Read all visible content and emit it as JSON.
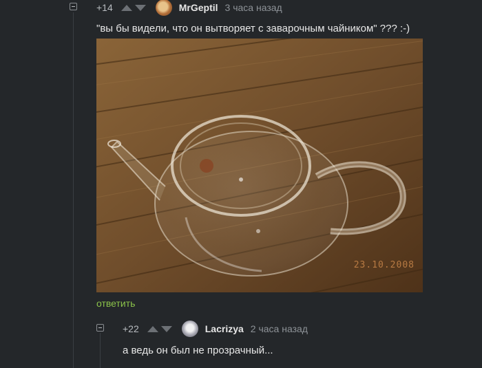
{
  "comment1": {
    "rating": "+14",
    "username": "MrGeptil",
    "timestamp": "3 часа назад",
    "text": "\"вы бы видели, что он вытворяет с заварочным чайником\" ??? :-)",
    "image_date_stamp": "23.10.2008",
    "reply_label": "ответить"
  },
  "comment2": {
    "rating": "+22",
    "username": "Lacrizya",
    "timestamp": "2 часа назад",
    "text": "а ведь он был не прозрачный..."
  },
  "colors": {
    "background": "#24272a",
    "reply_link": "#8bc34a",
    "muted_text": "#8e9398"
  }
}
